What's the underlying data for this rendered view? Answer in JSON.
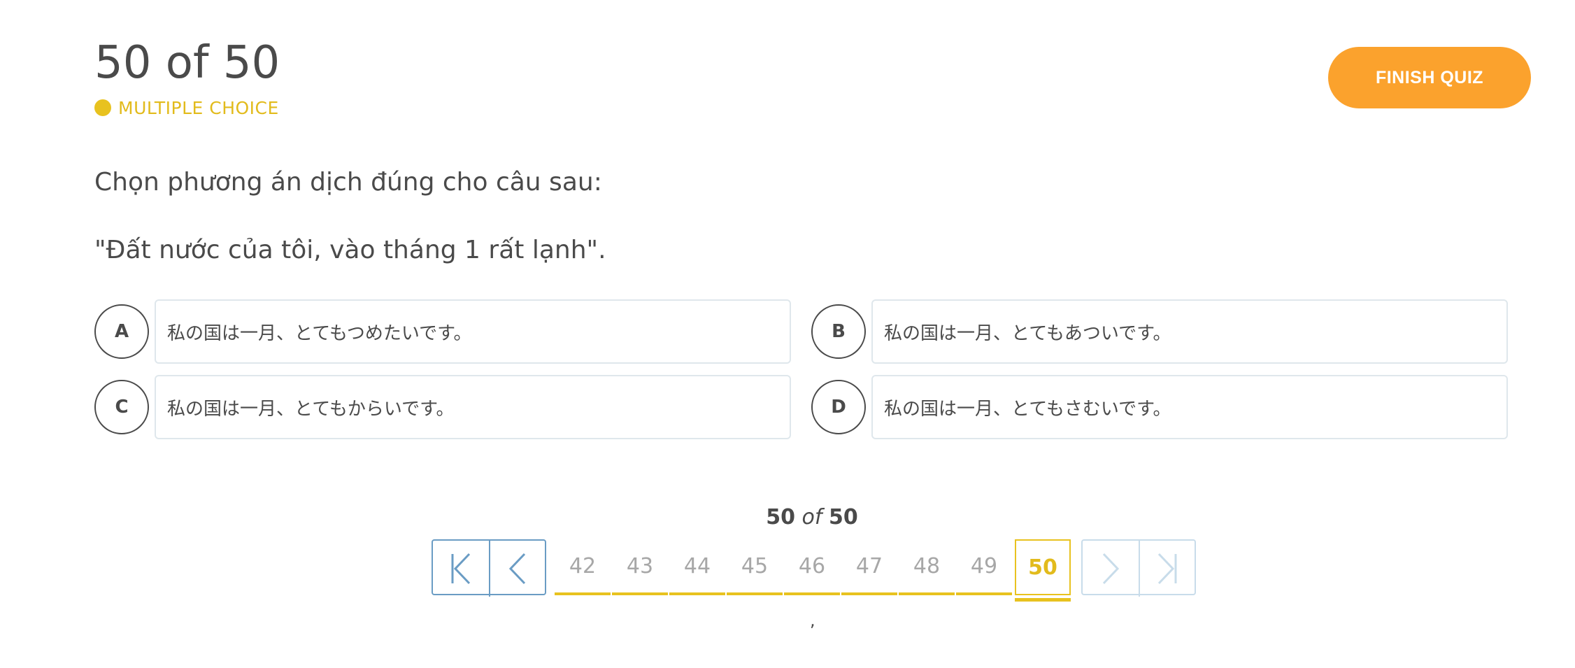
{
  "header": {
    "counter": "50 of 50",
    "question_type": "MULTIPLE CHOICE",
    "type_color": "#e8c21f",
    "finish_label": "FINISH QUIZ",
    "finish_color": "#fba22d"
  },
  "question": {
    "prompt": "Chọn phương án dịch đúng cho câu sau:",
    "sentence": "\"Đất nước của tôi, vào tháng 1 rất lạnh\"."
  },
  "options": [
    {
      "letter": "A",
      "text": "私の国は一月、とてもつめたいです。"
    },
    {
      "letter": "B",
      "text": "私の国は一月、とてもあついです。"
    },
    {
      "letter": "C",
      "text": "私の国は一月、とてもからいです。"
    },
    {
      "letter": "D",
      "text": "私の国は一月、とてもさむいです。"
    }
  ],
  "pagination": {
    "current": "50",
    "of_word": "of",
    "total": "50",
    "pages": [
      "42",
      "43",
      "44",
      "45",
      "46",
      "47",
      "48",
      "49",
      "50"
    ],
    "stray_mark": ","
  },
  "icons": {
    "first": "first-page-icon",
    "prev": "chevron-left-icon",
    "next": "chevron-right-icon",
    "last": "last-page-icon"
  }
}
